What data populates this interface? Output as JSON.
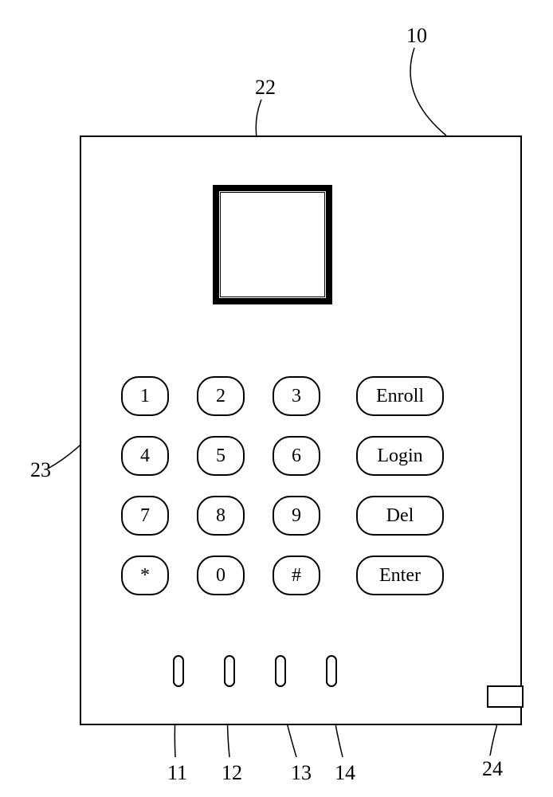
{
  "callouts": {
    "device": "10",
    "screen": "22",
    "keypad": "23",
    "slot1": "11",
    "slot2": "12",
    "slot3": "13",
    "slot4": "14",
    "port": "24"
  },
  "keys": {
    "r1c1": "1",
    "r1c2": "2",
    "r1c3": "3",
    "r1f": "Enroll",
    "r2c1": "4",
    "r2c2": "5",
    "r2c3": "6",
    "r2f": "Login",
    "r3c1": "7",
    "r3c2": "8",
    "r3c3": "9",
    "r3f": "Del",
    "r4c1": "*",
    "r4c2": "0",
    "r4c3": "#",
    "r4f": "Enter"
  }
}
